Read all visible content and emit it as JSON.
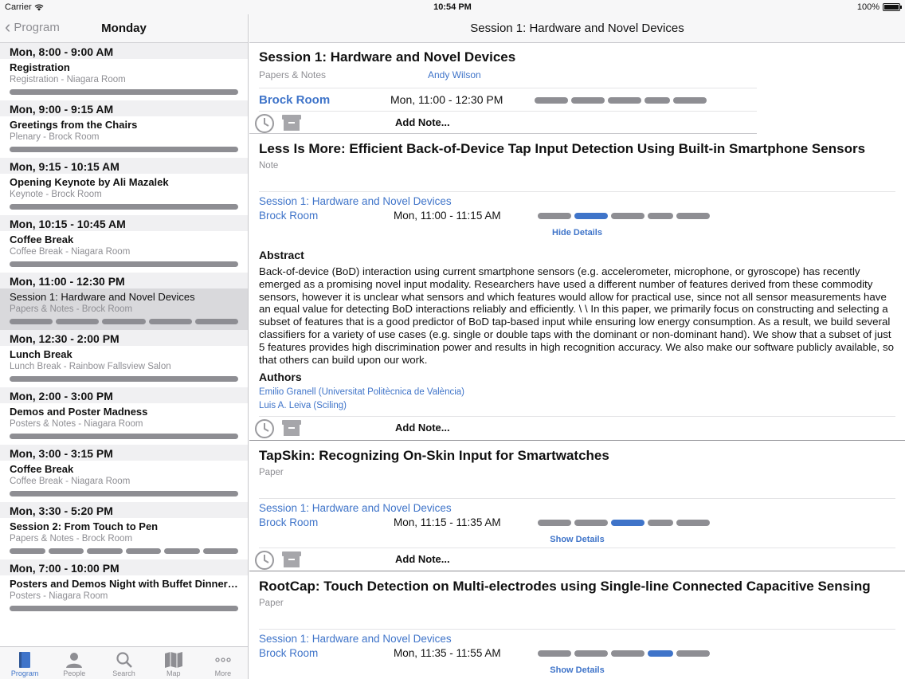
{
  "status": {
    "carrier": "Carrier",
    "time": "10:54 PM",
    "battery": "100%",
    "battery_level": 1.0
  },
  "left": {
    "back_label": "Program",
    "title": "Monday",
    "slots": [
      {
        "time": "Mon, 8:00 - 9:00 AM",
        "title": "Registration",
        "sub": "Registration - Niagara Room",
        "bars": 1,
        "selected": false
      },
      {
        "time": "Mon, 9:00 - 9:15 AM",
        "title": "Greetings from the Chairs",
        "sub": "Plenary - Brock Room",
        "bars": 1,
        "selected": false
      },
      {
        "time": "Mon, 9:15 - 10:15 AM",
        "title": "Opening Keynote by Ali Mazalek",
        "sub": "Keynote - Brock Room",
        "bars": 1,
        "selected": false
      },
      {
        "time": "Mon, 10:15 - 10:45 AM",
        "title": "Coffee Break",
        "sub": "Coffee Break - Niagara Room",
        "bars": 1,
        "selected": false
      },
      {
        "time": "Mon, 11:00 - 12:30 PM",
        "title": "Session 1: Hardware and Novel Devices",
        "sub": "Papers & Notes - Brock Room",
        "bars": 5,
        "selected": true
      },
      {
        "time": "Mon, 12:30 - 2:00 PM",
        "title": "Lunch Break",
        "sub": "Lunch Break - Rainbow Fallsview Salon",
        "bars": 1,
        "selected": false
      },
      {
        "time": "Mon, 2:00 - 3:00 PM",
        "title": "Demos and Poster Madness",
        "sub": "Posters & Notes - Niagara Room",
        "bars": 1,
        "selected": false
      },
      {
        "time": "Mon, 3:00 - 3:15 PM",
        "title": "Coffee Break",
        "sub": "Coffee Break - Niagara Room",
        "bars": 1,
        "selected": false
      },
      {
        "time": "Mon, 3:30 - 5:20 PM",
        "title": "Session 2: From Touch to Pen",
        "sub": "Papers & Notes - Brock Room",
        "bars": 6,
        "selected": false
      },
      {
        "time": "Mon, 7:00 - 10:00 PM",
        "title": "Posters and Demos Night with Buffet Dinner a...",
        "sub": "Posters - Niagara Room",
        "bars": 1,
        "selected": false
      }
    ],
    "tabs": [
      {
        "label": "Program",
        "icon": "book-icon",
        "active": true
      },
      {
        "label": "People",
        "icon": "person-icon",
        "active": false
      },
      {
        "label": "Search",
        "icon": "search-icon",
        "active": false
      },
      {
        "label": "Map",
        "icon": "map-icon",
        "active": false
      },
      {
        "label": "More",
        "icon": "more-icon",
        "active": false
      }
    ]
  },
  "right": {
    "nav_title": "Session 1: Hardware and Novel Devices",
    "session": {
      "title": "Session 1: Hardware and Novel Devices",
      "type": "Papers & Notes",
      "chair": "Andy Wilson",
      "room": "Brock Room",
      "time": "Mon, 11:00 - 12:30 PM",
      "add_note": "Add Note..."
    },
    "papers": [
      {
        "title": "Less Is More: Efficient Back-of-Device Tap Input Detection Using Built-in Smartphone Sensors",
        "type": "Note",
        "session": "Session 1: Hardware and Novel Devices",
        "room": "Brock Room",
        "time": "Mon, 11:00 - 11:15 AM",
        "active_bar": 2,
        "details_label": "Hide Details",
        "abstract_heading": "Abstract",
        "abstract": "Back-of-device (BoD) interaction using current smartphone sensors (e.g. accelerometer, microphone, or gyroscope) has recently emerged as a promising novel input modality. Researchers have used a different number of features derived from these commodity sensors, however it is unclear what sensors and which features would allow for practical use, since not all sensor measurements have an equal value for detecting BoD interactions reliably and efficiently. \\  \\ In this paper, we primarily focus on constructing and selecting a subset of features that is a good predictor of BoD tap-based input while ensuring low energy consumption. As a result, we build several classifiers for a variety of use cases (e.g. single or double taps with the dominant or non-dominant hand). We show that a subset of just 5 features provides high discrimination power and results in high recognition accuracy. We also make our software publicly available, so that others can build upon our work.",
        "authors_heading": "Authors",
        "authors": [
          "Emilio Granell (Universitat Politècnica de València)",
          "Luis A. Leiva (Sciling)"
        ],
        "add_note": "Add Note..."
      },
      {
        "title": "TapSkin: Recognizing On-Skin Input for Smartwatches",
        "type": "Paper",
        "session": "Session 1: Hardware and Novel Devices",
        "room": "Brock Room",
        "time": "Mon, 11:15 - 11:35 AM",
        "active_bar": 3,
        "details_label": "Show Details",
        "add_note": "Add Note..."
      },
      {
        "title": "RootCap: Touch Detection on Multi-electrodes using Single-line Connected Capacitive Sensing",
        "type": "Paper",
        "session": "Session 1: Hardware and Novel Devices",
        "room": "Brock Room",
        "time": "Mon, 11:35 - 11:55 AM",
        "active_bar": 4,
        "details_label": "Show Details"
      }
    ]
  },
  "colors": {
    "accent": "#3f74c9",
    "bar_grey": "#8e8e93",
    "selected_row": "#d9d9dc"
  }
}
